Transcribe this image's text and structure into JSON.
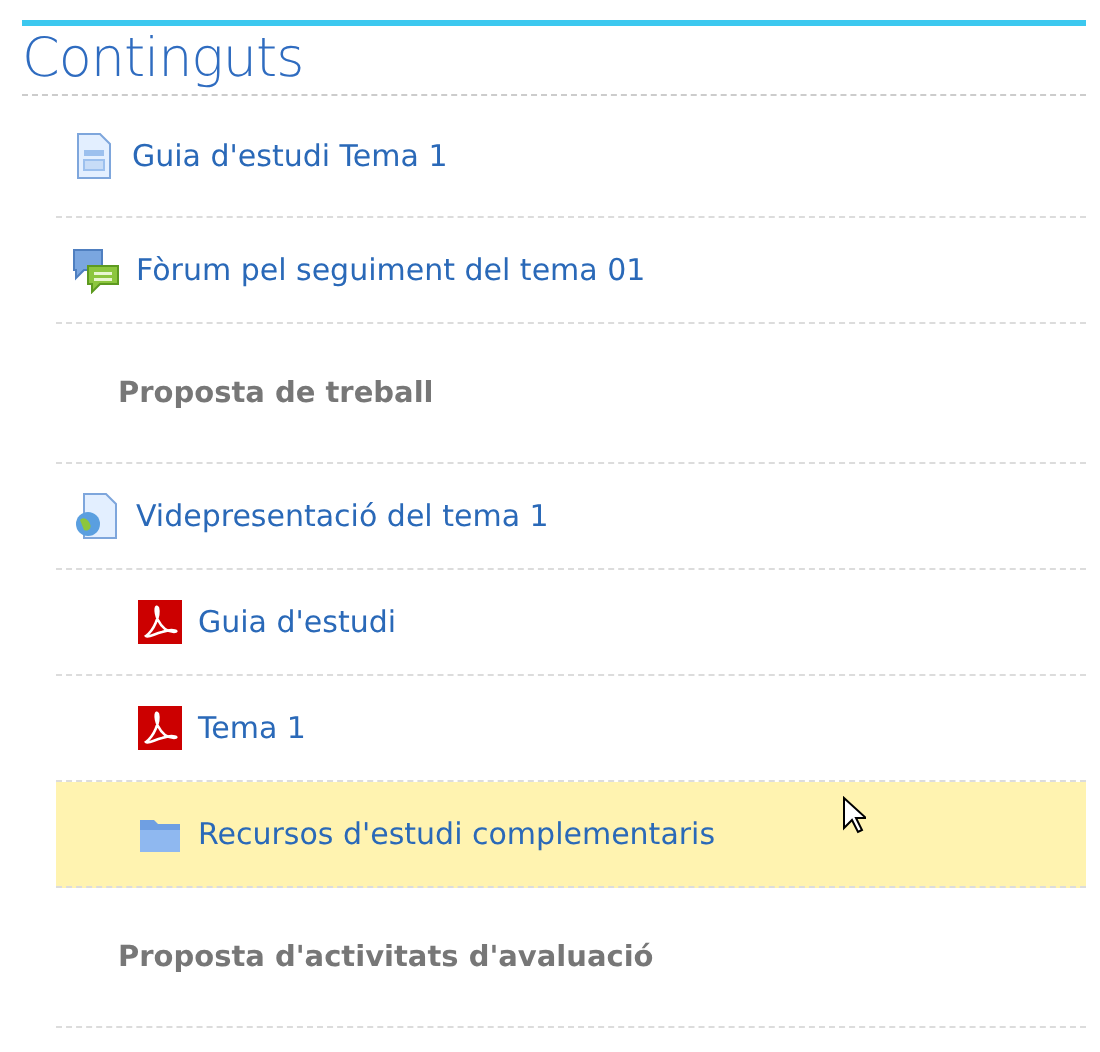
{
  "section": {
    "title": "Continguts"
  },
  "items": [
    {
      "kind": "page",
      "text": "Guia d'estudi Tema 1",
      "hovered": false
    },
    {
      "kind": "forum",
      "text": "Fòrum pel seguiment del tema 01",
      "hovered": false
    },
    {
      "kind": "label",
      "text": "Proposta de treball",
      "hovered": false
    },
    {
      "kind": "url",
      "text": "Videpresentació del tema 1",
      "hovered": false,
      "children": [
        {
          "kind": "pdf",
          "text": "Guia d'estudi",
          "hovered": false
        },
        {
          "kind": "pdf",
          "text": "Tema 1",
          "hovered": false
        },
        {
          "kind": "folder",
          "text": "Recursos d'estudi complementaris",
          "hovered": true
        }
      ]
    },
    {
      "kind": "label",
      "text": "Proposta d'activitats d'avaluació",
      "hovered": false
    }
  ]
}
